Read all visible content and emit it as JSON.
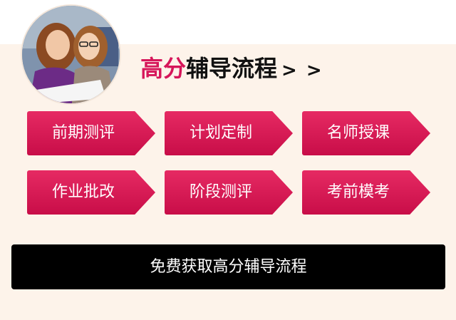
{
  "headline": {
    "accent": "高分",
    "rest": "辅导流程",
    "arrows": "> >"
  },
  "steps": [
    {
      "label": "前期测评"
    },
    {
      "label": "计划定制"
    },
    {
      "label": "名师授课"
    },
    {
      "label": "作业批改"
    },
    {
      "label": "阶段测评"
    },
    {
      "label": "考前模考"
    }
  ],
  "cta": {
    "label": "免费获取高分辅导流程"
  },
  "colors": {
    "accent": "#d6165a",
    "step_fill": "#e0195a",
    "cta_bg": "#000000",
    "band_bg": "#fdf3ea"
  }
}
